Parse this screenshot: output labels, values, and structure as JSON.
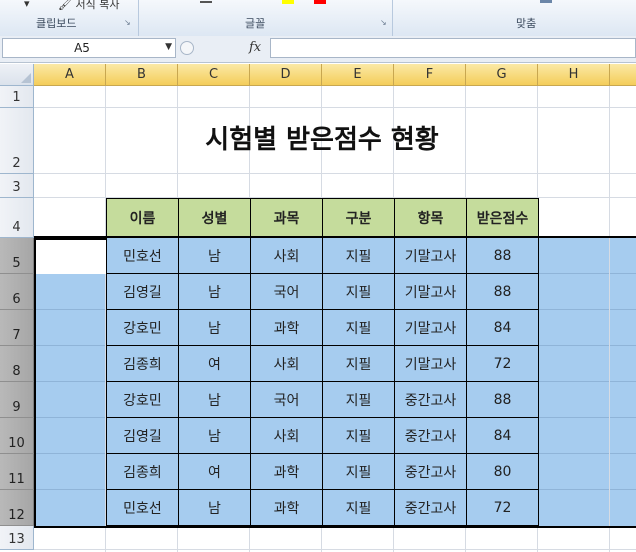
{
  "ribbon": {
    "format_painter_label": "서식 복사",
    "groups": [
      "클립보드",
      "글꼴",
      "맞춤"
    ]
  },
  "formula_bar": {
    "name_box_value": "A5",
    "fx_label": "fx",
    "formula_value": ""
  },
  "columns": [
    "A",
    "B",
    "C",
    "D",
    "E",
    "F",
    "G",
    "H"
  ],
  "rows": [
    "1",
    "2",
    "3",
    "4",
    "5",
    "6",
    "7",
    "8",
    "9",
    "10",
    "11",
    "12",
    "13"
  ],
  "sheet": {
    "title": "시험별 받은점수 현황",
    "headers": [
      "이름",
      "성별",
      "과목",
      "구분",
      "항목",
      "받은점수"
    ],
    "records": [
      [
        "민호선",
        "남",
        "사회",
        "지필",
        "기말고사",
        "88"
      ],
      [
        "김영길",
        "남",
        "국어",
        "지필",
        "기말고사",
        "88"
      ],
      [
        "강호민",
        "남",
        "과학",
        "지필",
        "기말고사",
        "84"
      ],
      [
        "김종희",
        "여",
        "사회",
        "지필",
        "기말고사",
        "72"
      ],
      [
        "강호민",
        "남",
        "국어",
        "지필",
        "중간고사",
        "88"
      ],
      [
        "김영길",
        "남",
        "사회",
        "지필",
        "중간고사",
        "84"
      ],
      [
        "김종희",
        "여",
        "과학",
        "지필",
        "중간고사",
        "80"
      ],
      [
        "민호선",
        "남",
        "과학",
        "지필",
        "중간고사",
        "72"
      ]
    ]
  },
  "colors": {
    "header_fill": "#c5dc9c",
    "selection_fill": "#a6ccef",
    "column_header": "#f4cd5a"
  }
}
